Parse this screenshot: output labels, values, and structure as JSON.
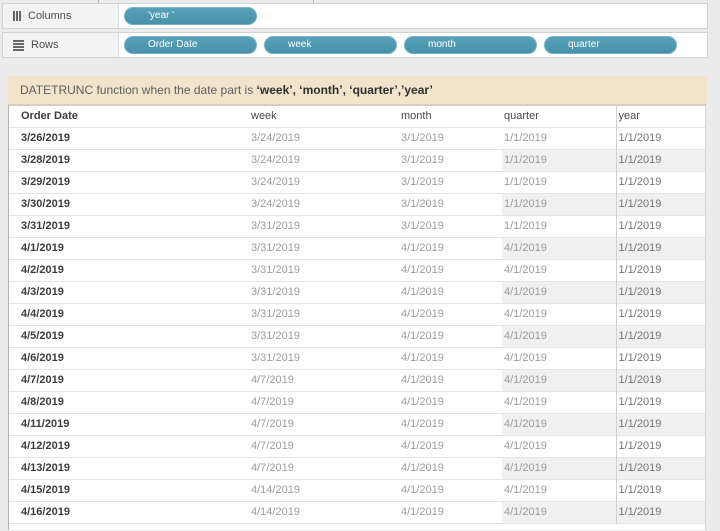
{
  "shelves": {
    "columns": {
      "label": "Columns",
      "pills": [
        "'year '"
      ]
    },
    "rows": {
      "label": "Rows",
      "pills": [
        "Order Date",
        "week",
        "month",
        "quarter"
      ]
    }
  },
  "title": {
    "prefix": "DATETRUNC function when the date part is ",
    "bold": "‘week’, ‘month’, ‘quarter’,’year’"
  },
  "table": {
    "headers": [
      "Order Date",
      "week",
      "month",
      "quarter",
      "year"
    ],
    "rows": [
      [
        "3/26/2019",
        "3/24/2019",
        "3/1/2019",
        "1/1/2019",
        "1/1/2019"
      ],
      [
        "3/28/2019",
        "3/24/2019",
        "3/1/2019",
        "1/1/2019",
        "1/1/2019"
      ],
      [
        "3/29/2019",
        "3/24/2019",
        "3/1/2019",
        "1/1/2019",
        "1/1/2019"
      ],
      [
        "3/30/2019",
        "3/24/2019",
        "3/1/2019",
        "1/1/2019",
        "1/1/2019"
      ],
      [
        "3/31/2019",
        "3/31/2019",
        "3/1/2019",
        "1/1/2019",
        "1/1/2019"
      ],
      [
        "4/1/2019",
        "3/31/2019",
        "4/1/2019",
        "4/1/2019",
        "1/1/2019"
      ],
      [
        "4/2/2019",
        "3/31/2019",
        "4/1/2019",
        "4/1/2019",
        "1/1/2019"
      ],
      [
        "4/3/2019",
        "3/31/2019",
        "4/1/2019",
        "4/1/2019",
        "1/1/2019"
      ],
      [
        "4/4/2019",
        "3/31/2019",
        "4/1/2019",
        "4/1/2019",
        "1/1/2019"
      ],
      [
        "4/5/2019",
        "3/31/2019",
        "4/1/2019",
        "4/1/2019",
        "1/1/2019"
      ],
      [
        "4/6/2019",
        "3/31/2019",
        "4/1/2019",
        "4/1/2019",
        "1/1/2019"
      ],
      [
        "4/7/2019",
        "4/7/2019",
        "4/1/2019",
        "4/1/2019",
        "1/1/2019"
      ],
      [
        "4/8/2019",
        "4/7/2019",
        "4/1/2019",
        "4/1/2019",
        "1/1/2019"
      ],
      [
        "4/11/2019",
        "4/7/2019",
        "4/1/2019",
        "4/1/2019",
        "1/1/2019"
      ],
      [
        "4/12/2019",
        "4/7/2019",
        "4/1/2019",
        "4/1/2019",
        "1/1/2019"
      ],
      [
        "4/13/2019",
        "4/7/2019",
        "4/1/2019",
        "4/1/2019",
        "1/1/2019"
      ],
      [
        "4/15/2019",
        "4/14/2019",
        "4/1/2019",
        "4/1/2019",
        "1/1/2019"
      ],
      [
        "4/16/2019",
        "4/14/2019",
        "4/1/2019",
        "4/1/2019",
        "1/1/2019"
      ]
    ]
  },
  "colors": {
    "pill": "#4b97ae",
    "title_bg": "#f2e4cb",
    "band": "#f0f0f0",
    "page_bg": "#ebebeb"
  }
}
